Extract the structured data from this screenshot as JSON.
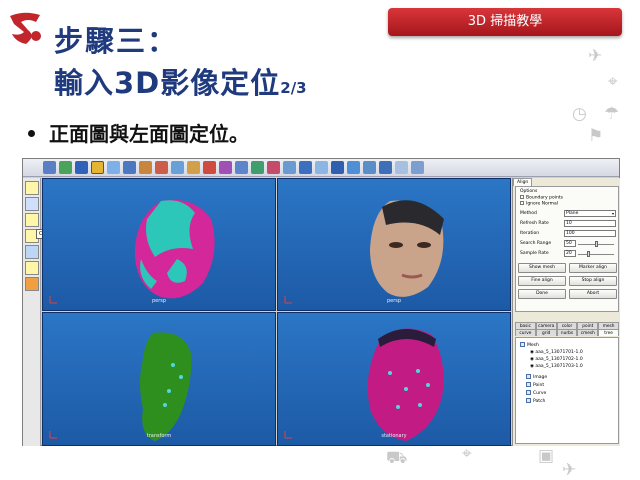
{
  "slide": {
    "badge": "3D 掃描教學",
    "title_line1": "步驟三：",
    "title_line2_main": "輸入3D影像定位",
    "title_line2_fraction": "2/3",
    "bullet": "正面圖與左面圖定位。"
  },
  "app": {
    "tooltip": "Curve",
    "viewports": [
      {
        "label": "persp"
      },
      {
        "label": "persp"
      },
      {
        "label": "transform"
      },
      {
        "label": "stationary"
      }
    ],
    "panel": {
      "top_tab": "Align",
      "options_label": "Options",
      "boundary_points": "Boundary points",
      "ignore_normal": "Ignore Normal",
      "method_label": "Method",
      "method_value": "Plane",
      "refresh_label": "Refresh Rate",
      "refresh_value": "10",
      "iteration_label": "Iteration",
      "iteration_value": "100",
      "search_label": "Search Range",
      "search_value": "50",
      "sample_label": "Sample Rate",
      "sample_value": "20",
      "buttons": {
        "show_mesh": "Show mesh",
        "marker_align": "Marker align",
        "fine_align": "Fine align",
        "stop_align": "Stop align",
        "done": "Done",
        "abort": "Abort"
      },
      "tabs_row1": [
        "basic",
        "camera",
        "color",
        "point",
        "mesh"
      ],
      "tabs_row2": [
        "curve",
        "grid",
        "nurbs",
        "cmesh",
        "tree"
      ],
      "tree": {
        "mesh": "Mesh",
        "files": [
          "aaa_5_13071701-1.0",
          "aaa_5_13071702-1.0",
          "aaa_5_13071703-1.0"
        ],
        "image": "Image",
        "point": "Point",
        "curve": "Curve",
        "patch": "Patch"
      }
    }
  }
}
